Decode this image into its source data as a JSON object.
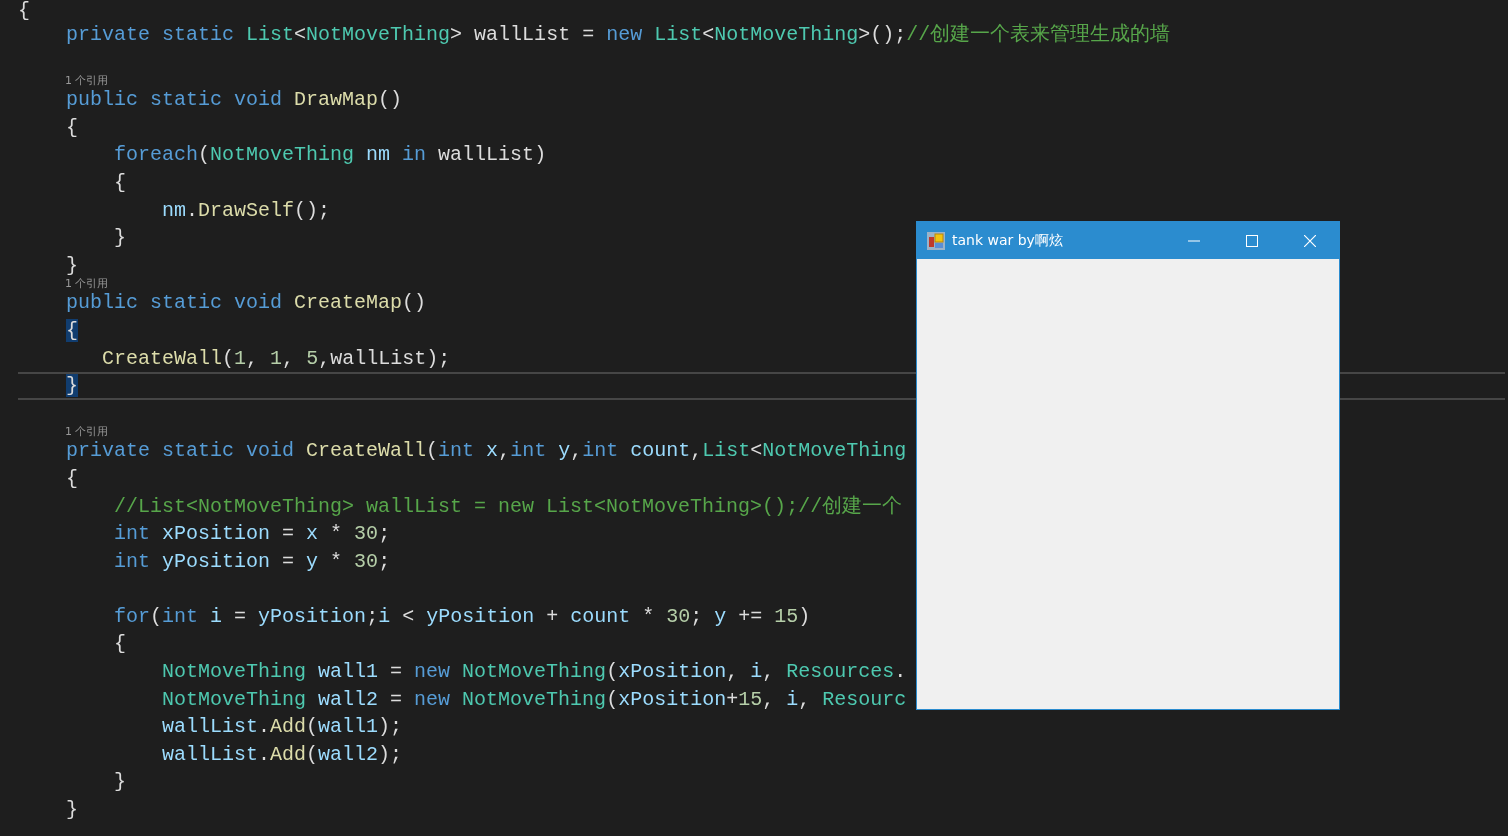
{
  "editor": {
    "lines": [
      {
        "kind": "code",
        "current": false,
        "segments": [
          {
            "text": "{",
            "kind": "plain"
          }
        ]
      },
      {
        "kind": "code",
        "current": false,
        "segments": [
          {
            "text": "    private static ",
            "kind": "keyword"
          },
          {
            "text": "List",
            "kind": "type"
          },
          {
            "text": "<",
            "kind": "plain"
          },
          {
            "text": "NotMoveThing",
            "kind": "type"
          },
          {
            "text": "> wallList = ",
            "kind": "plain"
          },
          {
            "text": "new ",
            "kind": "keyword"
          },
          {
            "text": "List",
            "kind": "type"
          },
          {
            "text": "<",
            "kind": "plain"
          },
          {
            "text": "NotMoveThing",
            "kind": "type"
          },
          {
            "text": ">();",
            "kind": "plain"
          },
          {
            "text": "//创建一个表来管理生成的墙",
            "kind": "comment"
          }
        ]
      },
      {
        "kind": "blank"
      },
      {
        "kind": "codelens",
        "text": "1 个引用"
      },
      {
        "kind": "code",
        "current": false,
        "segments": [
          {
            "text": "    public static void ",
            "kind": "keyword"
          },
          {
            "text": "DrawMap",
            "kind": "method"
          },
          {
            "text": "()",
            "kind": "plain"
          }
        ]
      },
      {
        "kind": "code",
        "current": false,
        "segments": [
          {
            "text": "    {",
            "kind": "plain"
          }
        ]
      },
      {
        "kind": "code",
        "current": false,
        "segments": [
          {
            "text": "        foreach",
            "kind": "keyword"
          },
          {
            "text": "(",
            "kind": "plain"
          },
          {
            "text": "NotMoveThing",
            "kind": "type"
          },
          {
            "text": " nm ",
            "kind": "variable"
          },
          {
            "text": "in ",
            "kind": "keyword"
          },
          {
            "text": "wallList)",
            "kind": "plain"
          }
        ]
      },
      {
        "kind": "code",
        "current": false,
        "segments": [
          {
            "text": "        {",
            "kind": "plain"
          }
        ]
      },
      {
        "kind": "code",
        "current": false,
        "segments": [
          {
            "text": "            nm",
            "kind": "variable"
          },
          {
            "text": ".",
            "kind": "plain"
          },
          {
            "text": "DrawSelf",
            "kind": "method"
          },
          {
            "text": "();",
            "kind": "plain"
          }
        ]
      },
      {
        "kind": "code",
        "current": false,
        "segments": [
          {
            "text": "        }",
            "kind": "plain"
          }
        ]
      },
      {
        "kind": "code",
        "current": false,
        "segments": [
          {
            "text": "    }",
            "kind": "plain"
          }
        ]
      },
      {
        "kind": "codelens",
        "text": "1 个引用"
      },
      {
        "kind": "code",
        "current": false,
        "segments": [
          {
            "text": "    public static void ",
            "kind": "keyword"
          },
          {
            "text": "CreateMap",
            "kind": "method"
          },
          {
            "text": "()",
            "kind": "plain"
          }
        ]
      },
      {
        "kind": "code",
        "current": false,
        "brace_highlight": true,
        "segments": [
          {
            "text": "    {",
            "kind": "plain"
          }
        ]
      },
      {
        "kind": "code",
        "current": false,
        "segments": [
          {
            "text": "       CreateWall",
            "kind": "method"
          },
          {
            "text": "(",
            "kind": "plain"
          },
          {
            "text": "1",
            "kind": "number"
          },
          {
            "text": ", ",
            "kind": "plain"
          },
          {
            "text": "1",
            "kind": "number"
          },
          {
            "text": ", ",
            "kind": "plain"
          },
          {
            "text": "5",
            "kind": "number"
          },
          {
            "text": ",wallList);",
            "kind": "plain"
          }
        ]
      },
      {
        "kind": "code",
        "current": true,
        "brace_highlight": true,
        "segments": [
          {
            "text": "    }",
            "kind": "plain"
          }
        ]
      },
      {
        "kind": "blank"
      },
      {
        "kind": "codelens",
        "text": "1 个引用"
      },
      {
        "kind": "code",
        "current": false,
        "segments": [
          {
            "text": "    private static void ",
            "kind": "keyword"
          },
          {
            "text": "CreateWall",
            "kind": "method"
          },
          {
            "text": "(",
            "kind": "plain"
          },
          {
            "text": "int ",
            "kind": "keyword"
          },
          {
            "text": "x",
            "kind": "variable"
          },
          {
            "text": ",",
            "kind": "plain"
          },
          {
            "text": "int ",
            "kind": "keyword"
          },
          {
            "text": "y",
            "kind": "variable"
          },
          {
            "text": ",",
            "kind": "plain"
          },
          {
            "text": "int ",
            "kind": "keyword"
          },
          {
            "text": "count",
            "kind": "variable"
          },
          {
            "text": ",",
            "kind": "plain"
          },
          {
            "text": "List",
            "kind": "type"
          },
          {
            "text": "<",
            "kind": "plain"
          },
          {
            "text": "NotMoveThing",
            "kind": "type"
          }
        ]
      },
      {
        "kind": "code",
        "current": false,
        "segments": [
          {
            "text": "    {",
            "kind": "plain"
          }
        ]
      },
      {
        "kind": "code",
        "current": false,
        "segments": [
          {
            "text": "        //List<NotMoveThing> wallList = new List<NotMoveThing>();//创建一个",
            "kind": "comment"
          }
        ]
      },
      {
        "kind": "code",
        "current": false,
        "segments": [
          {
            "text": "        int ",
            "kind": "keyword"
          },
          {
            "text": "xPosition",
            "kind": "variable"
          },
          {
            "text": " = ",
            "kind": "plain"
          },
          {
            "text": "x",
            "kind": "variable"
          },
          {
            "text": " * ",
            "kind": "plain"
          },
          {
            "text": "30",
            "kind": "number"
          },
          {
            "text": ";",
            "kind": "plain"
          }
        ]
      },
      {
        "kind": "code",
        "current": false,
        "segments": [
          {
            "text": "        int ",
            "kind": "keyword"
          },
          {
            "text": "yPosition",
            "kind": "variable"
          },
          {
            "text": " = ",
            "kind": "plain"
          },
          {
            "text": "y",
            "kind": "variable"
          },
          {
            "text": " * ",
            "kind": "plain"
          },
          {
            "text": "30",
            "kind": "number"
          },
          {
            "text": ";",
            "kind": "plain"
          }
        ]
      },
      {
        "kind": "blank"
      },
      {
        "kind": "code",
        "current": false,
        "segments": [
          {
            "text": "        for",
            "kind": "keyword"
          },
          {
            "text": "(",
            "kind": "plain"
          },
          {
            "text": "int ",
            "kind": "keyword"
          },
          {
            "text": "i",
            "kind": "variable"
          },
          {
            "text": " = ",
            "kind": "plain"
          },
          {
            "text": "yPosition",
            "kind": "variable"
          },
          {
            "text": ";",
            "kind": "plain"
          },
          {
            "text": "i",
            "kind": "variable"
          },
          {
            "text": " < ",
            "kind": "plain"
          },
          {
            "text": "yPosition",
            "kind": "variable"
          },
          {
            "text": " + ",
            "kind": "plain"
          },
          {
            "text": "count",
            "kind": "variable"
          },
          {
            "text": " * ",
            "kind": "plain"
          },
          {
            "text": "30",
            "kind": "number"
          },
          {
            "text": "; ",
            "kind": "plain"
          },
          {
            "text": "y",
            "kind": "variable"
          },
          {
            "text": " += ",
            "kind": "plain"
          },
          {
            "text": "15",
            "kind": "number"
          },
          {
            "text": ")",
            "kind": "plain"
          }
        ]
      },
      {
        "kind": "code",
        "current": false,
        "segments": [
          {
            "text": "        {",
            "kind": "plain"
          }
        ]
      },
      {
        "kind": "code",
        "current": false,
        "segments": [
          {
            "text": "            NotMoveThing",
            "kind": "type"
          },
          {
            "text": " wall1",
            "kind": "variable"
          },
          {
            "text": " = ",
            "kind": "plain"
          },
          {
            "text": "new ",
            "kind": "keyword"
          },
          {
            "text": "NotMoveThing",
            "kind": "type"
          },
          {
            "text": "(",
            "kind": "plain"
          },
          {
            "text": "xPosition",
            "kind": "variable"
          },
          {
            "text": ", ",
            "kind": "plain"
          },
          {
            "text": "i",
            "kind": "variable"
          },
          {
            "text": ", ",
            "kind": "plain"
          },
          {
            "text": "Resources",
            "kind": "type"
          },
          {
            "text": ".",
            "kind": "plain"
          }
        ]
      },
      {
        "kind": "code",
        "current": false,
        "segments": [
          {
            "text": "            NotMoveThing",
            "kind": "type"
          },
          {
            "text": " wall2",
            "kind": "variable"
          },
          {
            "text": " = ",
            "kind": "plain"
          },
          {
            "text": "new ",
            "kind": "keyword"
          },
          {
            "text": "NotMoveThing",
            "kind": "type"
          },
          {
            "text": "(",
            "kind": "plain"
          },
          {
            "text": "xPosition",
            "kind": "variable"
          },
          {
            "text": "+",
            "kind": "plain"
          },
          {
            "text": "15",
            "kind": "number"
          },
          {
            "text": ", ",
            "kind": "plain"
          },
          {
            "text": "i",
            "kind": "variable"
          },
          {
            "text": ", ",
            "kind": "plain"
          },
          {
            "text": "Resourc",
            "kind": "type"
          }
        ]
      },
      {
        "kind": "code",
        "current": false,
        "segments": [
          {
            "text": "            wallList",
            "kind": "variable"
          },
          {
            "text": ".",
            "kind": "plain"
          },
          {
            "text": "Add",
            "kind": "method"
          },
          {
            "text": "(",
            "kind": "plain"
          },
          {
            "text": "wall1",
            "kind": "variable"
          },
          {
            "text": ");",
            "kind": "plain"
          }
        ]
      },
      {
        "kind": "code",
        "current": false,
        "segments": [
          {
            "text": "            wallList",
            "kind": "variable"
          },
          {
            "text": ".",
            "kind": "plain"
          },
          {
            "text": "Add",
            "kind": "method"
          },
          {
            "text": "(",
            "kind": "plain"
          },
          {
            "text": "wall2",
            "kind": "variable"
          },
          {
            "text": ");",
            "kind": "plain"
          }
        ]
      },
      {
        "kind": "code",
        "current": false,
        "segments": [
          {
            "text": "        }",
            "kind": "plain"
          }
        ]
      },
      {
        "kind": "code",
        "current": false,
        "segments": [
          {
            "text": "    }",
            "kind": "plain"
          }
        ]
      }
    ]
  },
  "window": {
    "title": "tank war by啊炫"
  }
}
